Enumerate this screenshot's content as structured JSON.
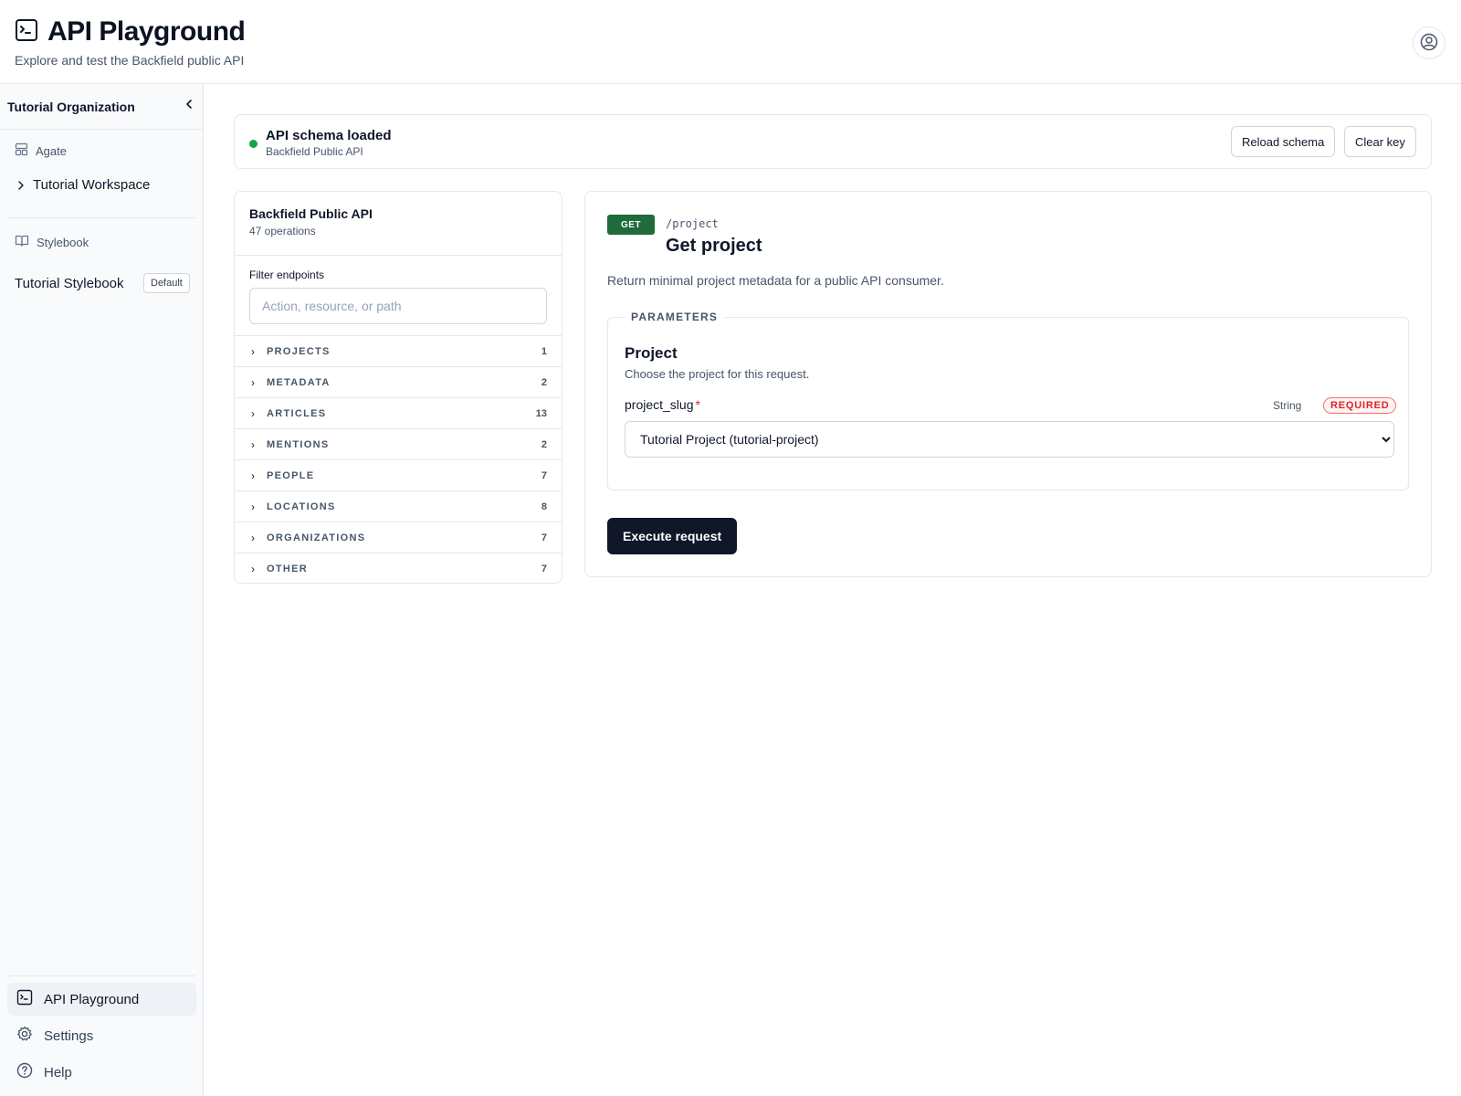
{
  "header": {
    "title": "API Playground",
    "subtitle": "Explore and test the Backfield public API",
    "title_icon": "terminal-icon",
    "user_icon": "user-circle-icon"
  },
  "sidebar": {
    "org_name": "Tutorial Organization",
    "sections": [
      {
        "label": "Agate",
        "icon": "layout-icon",
        "items": [
          {
            "label": "Tutorial Workspace"
          }
        ]
      },
      {
        "label": "Stylebook",
        "icon": "book-icon",
        "items": [
          {
            "label": "Tutorial Stylebook",
            "badge": "Default"
          }
        ]
      }
    ],
    "nav": [
      {
        "label": "API Playground",
        "icon": "terminal-icon",
        "active": true
      },
      {
        "label": "Settings",
        "icon": "gear-icon"
      },
      {
        "label": "Help",
        "icon": "help-icon"
      }
    ]
  },
  "status": {
    "title": "API schema loaded",
    "subtitle": "Backfield Public API",
    "status_color": "#16a34a",
    "reload_label": "Reload schema",
    "clear_label": "Clear key"
  },
  "endpoints": {
    "title": "Backfield Public API",
    "count": "47 operations",
    "filter_label": "Filter endpoints",
    "filter_placeholder": "Action, resource, or path",
    "categories": [
      {
        "name": "PROJECTS",
        "count": "1"
      },
      {
        "name": "METADATA",
        "count": "2"
      },
      {
        "name": "ARTICLES",
        "count": "13"
      },
      {
        "name": "MENTIONS",
        "count": "2"
      },
      {
        "name": "PEOPLE",
        "count": "7"
      },
      {
        "name": "LOCATIONS",
        "count": "8"
      },
      {
        "name": "ORGANIZATIONS",
        "count": "7"
      },
      {
        "name": "OTHER",
        "count": "7"
      }
    ]
  },
  "operation": {
    "method": "GET",
    "method_color": "#1f6b3a",
    "path": "/project",
    "title": "Get project",
    "description": "Return minimal project metadata for a public API consumer.",
    "params_legend": "PARAMETERS",
    "group_title": "Project",
    "group_desc": "Choose the project for this request.",
    "param_name": "project_slug",
    "required_mark": "*",
    "param_type": "String",
    "required_label": "REQUIRED",
    "selected_value": "Tutorial Project (tutorial-project)",
    "execute_label": "Execute request"
  }
}
